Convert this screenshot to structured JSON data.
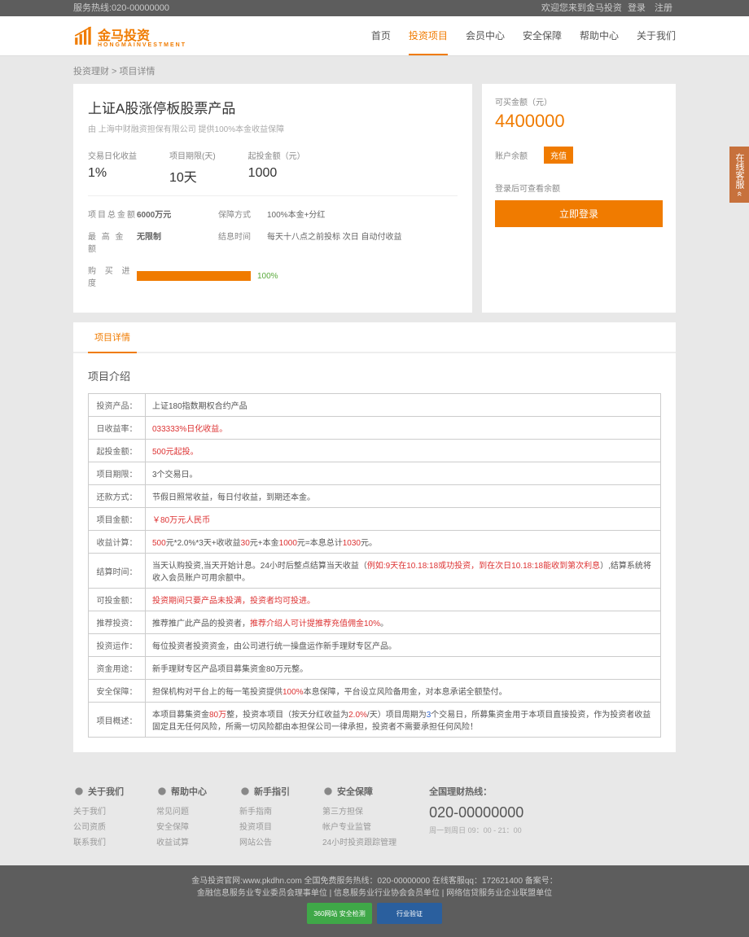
{
  "topbar": {
    "hotline": "服务热线:020-00000000",
    "welcome": "欢迎您来到金马投资",
    "login": "登录",
    "register": "注册"
  },
  "logo": {
    "name": "金马投资",
    "sub": "HONGMAINVESTMENT"
  },
  "nav": [
    "首页",
    "投资项目",
    "会员中心",
    "安全保障",
    "帮助中心",
    "关于我们"
  ],
  "breadcrumb": {
    "a": "投资理财",
    "b": "项目详情"
  },
  "product": {
    "title": "上证A股涨停板股票产品",
    "subtitle": "由 上海中财融资担保有限公司 提供100%本金收益保障",
    "stat1_label": "交易日化收益",
    "stat1_val": "1%",
    "stat2_label": "项目期限(天)",
    "stat2_val": "10天",
    "stat3_label": "起投金额（元）",
    "stat3_val": "1000",
    "r1l": "项目总金额",
    "r1v": "6000万元",
    "r1l2": "保障方式",
    "r1v2": "100%本金+分红",
    "r2l": "最 高 金 额",
    "r2v": "无限制",
    "r2l2": "结息时间",
    "r2v2": "每天十八点之前投标 次日 自动付收益",
    "prog_label": "购 买 进 度",
    "prog_pct": "100%"
  },
  "side": {
    "avail_label": "可买金额（元）",
    "avail": "4400000",
    "bal_label": "账户余额",
    "recharge": "充值",
    "tip": "登录后可查看余额",
    "login_btn": "立即登录"
  },
  "tab": "项目详情",
  "sec": "项目介绍",
  "rows": [
    {
      "k": "投资产品：",
      "v": "上证180指数期权合约产品"
    },
    {
      "k": "日收益率：",
      "v": "033333%日化收益。",
      "red": true
    },
    {
      "k": "起投金额：",
      "v": "500元起投。",
      "red": true
    },
    {
      "k": "项目期限：",
      "v": "3个交易日。"
    },
    {
      "k": "还款方式：",
      "v": "节假日照常收益，每日付收益，到期还本金。"
    },
    {
      "k": "项目金额：",
      "v": "￥80万元人民币",
      "red": true
    },
    {
      "k": "收益计算：",
      "v": "500元*2.0%*3天+收收益30元+本金1000元=本息总计1030元。",
      "calc": true
    },
    {
      "k": "结算时间：",
      "v": "当天认购投资,当天开始计息。24小时后整点结算当天收益",
      "settle": true
    },
    {
      "k": "可投金额：",
      "v": "投资期间只要产品未投满，投资者均可投进。",
      "red": true
    },
    {
      "k": "推荐投资：",
      "v": "推荐推广此产品的投资者，",
      "rec": true
    },
    {
      "k": "投资运作：",
      "v": "每位投资者投资资金，由公司进行统一操盘运作新手理财专区产品。"
    },
    {
      "k": "资金用途：",
      "v": "新手理财专区产品项目募集资金80万元整。"
    },
    {
      "k": "安全保障：",
      "v": "担保机构对平台上的每一笔投资提供",
      "safe": true
    },
    {
      "k": "项目概述：",
      "v": "",
      "desc": true
    }
  ],
  "footer": {
    "cols": [
      {
        "t": "关于我们",
        "items": [
          "关于我们",
          "公司资质",
          "联系我们"
        ]
      },
      {
        "t": "帮助中心",
        "items": [
          "常见问题",
          "安全保障",
          "收益试算"
        ]
      },
      {
        "t": "新手指引",
        "items": [
          "新手指南",
          "投资项目",
          "网站公告"
        ]
      },
      {
        "t": "安全保障",
        "items": [
          "第三方担保",
          "帐户专业监管",
          "24小时投资跟踪管理"
        ]
      }
    ],
    "hotline_label": "全国理财热线：",
    "hotline": "020-00000000",
    "time": "周一到周日 09：00 - 21：00",
    "bottom1": "金马投资官网:www.pkdhn.com 全国免费服务热线：020-00000000 在线客服qq：172621400 备案号：",
    "bottom2": "金融信息服务业专业委员会理事单位 | 信息服务业行业协会会员单位 | 网络信贷服务业企业联盟单位",
    "badge1": "360网站 安全检测",
    "badge2": "行业验证"
  },
  "floater": "在线客服 «"
}
